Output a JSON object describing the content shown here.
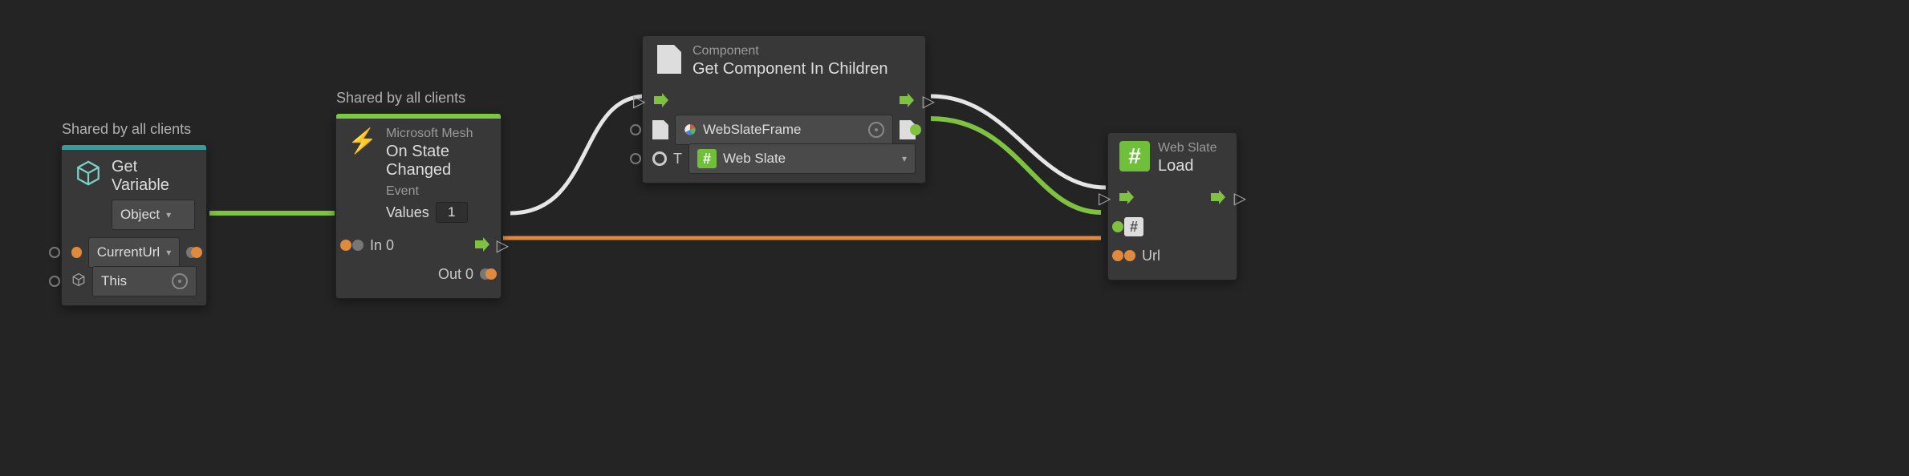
{
  "shared_label": "Shared by all clients",
  "node1": {
    "title": "Get Variable",
    "kind_field": "Object",
    "var_field": "CurrentUrl",
    "self_field": "This"
  },
  "node2": {
    "category": "Microsoft Mesh",
    "title": "On State Changed",
    "section": "Event",
    "values_label": "Values",
    "values_count": "1",
    "in0": "In 0",
    "out0": "Out 0"
  },
  "node3": {
    "category": "Component",
    "title": "Get Component In Children",
    "gameobject": "WebSlateFrame",
    "type_prefix": "T",
    "type_value": "Web Slate"
  },
  "node4": {
    "category": "Web Slate",
    "title": "Load",
    "url_label": "Url"
  }
}
